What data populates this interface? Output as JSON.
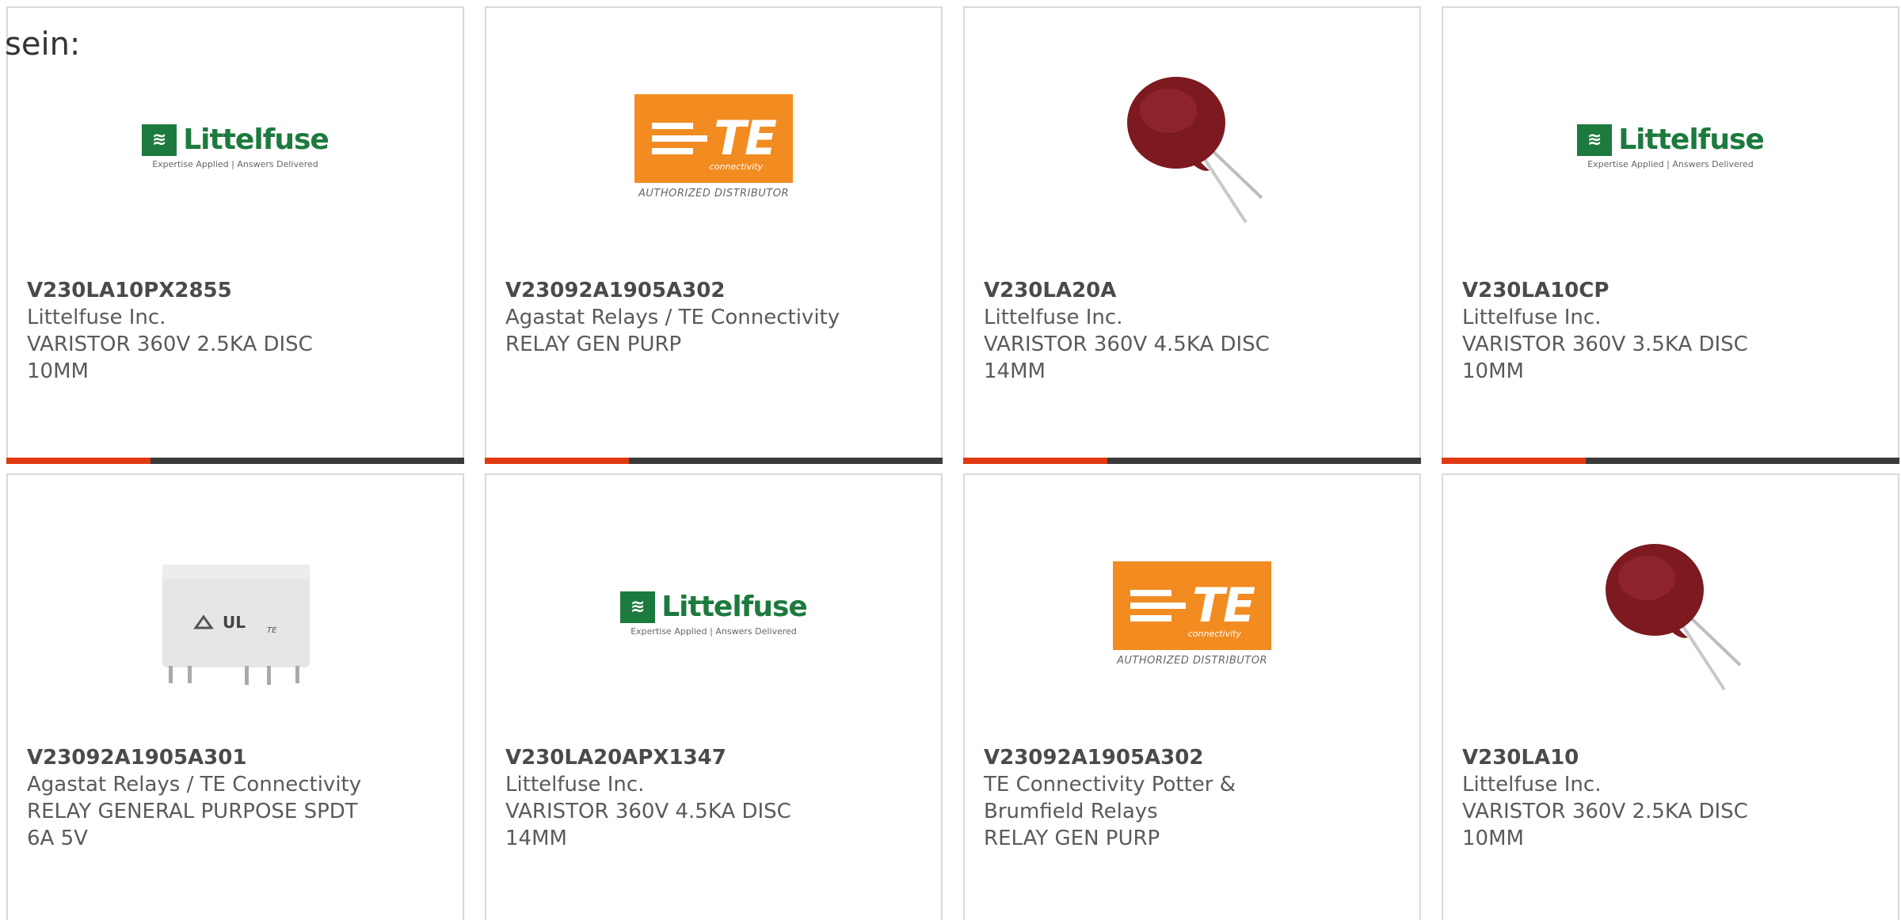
{
  "intro_text": "sein:",
  "colors": {
    "card_border": "#d9d9d9",
    "bar_dark": "#3a3a3a",
    "bar_accent": "#e03a12",
    "littelfuse_green": "#1d7a3e",
    "te_orange": "#f28c21",
    "varistor_red": "#8a1c22"
  },
  "logos": {
    "littelfuse": {
      "name": "Littelfuse",
      "tagline": "Expertise Applied | Answers Delivered"
    },
    "te": {
      "name": "TE",
      "sub": "connectivity",
      "distributor": "AUTHORIZED DISTRIBUTOR"
    }
  },
  "products": [
    {
      "image": "littelfuse-logo",
      "part_number": "V230LA10PX2855",
      "manufacturer": "Littelfuse Inc.",
      "desc1": "VARISTOR 360V 2.5KA DISC",
      "desc2": "10MM"
    },
    {
      "image": "te-logo",
      "part_number": "V23092A1905A302",
      "manufacturer": "Agastat Relays / TE Connectivity",
      "desc1": "RELAY GEN PURP",
      "desc2": ""
    },
    {
      "image": "varistor-disc-photo",
      "part_number": "V230LA20A",
      "manufacturer": "Littelfuse Inc.",
      "desc1": "VARISTOR 360V 4.5KA DISC",
      "desc2": "14MM"
    },
    {
      "image": "littelfuse-logo",
      "part_number": "V230LA10CP",
      "manufacturer": "Littelfuse Inc.",
      "desc1": "VARISTOR 360V 3.5KA DISC",
      "desc2": "10MM"
    },
    {
      "image": "relay-photo",
      "part_number": "V23092A1905A301",
      "manufacturer": "Agastat Relays / TE Connectivity",
      "desc1": "RELAY GENERAL PURPOSE SPDT",
      "desc2": "6A 5V"
    },
    {
      "image": "littelfuse-logo",
      "part_number": "V230LA20APX1347",
      "manufacturer": "Littelfuse Inc.",
      "desc1": "VARISTOR 360V 4.5KA DISC",
      "desc2": "14MM"
    },
    {
      "image": "te-logo",
      "part_number": "V23092A1905A302",
      "manufacturer": "TE Connectivity Potter &",
      "manufacturer2": "Brumfield Relays",
      "desc1": "RELAY GEN PURP",
      "desc2": ""
    },
    {
      "image": "varistor-disc-photo",
      "part_number": "V230LA10",
      "manufacturer": "Littelfuse Inc.",
      "desc1": "VARISTOR 360V 2.5KA DISC",
      "desc2": "10MM"
    }
  ]
}
